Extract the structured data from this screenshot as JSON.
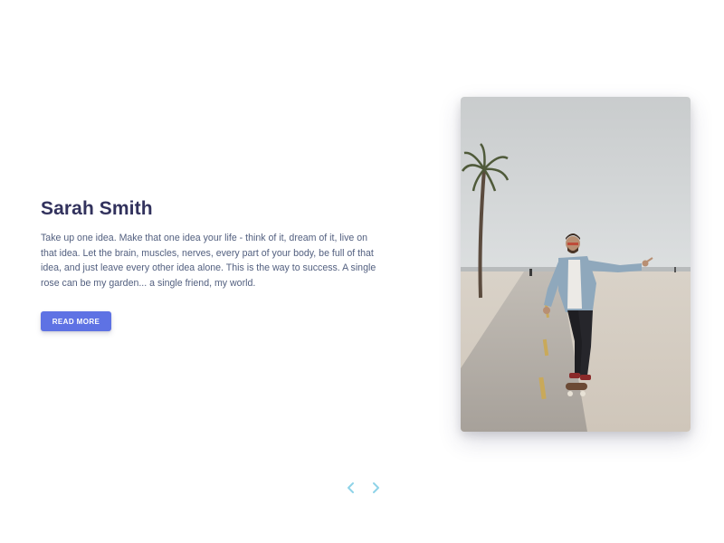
{
  "profile": {
    "name": "Sarah Smith",
    "description": "Take up one idea. Make that one idea your life - think of it, dream of it, live on that idea. Let the brain, muscles, nerves, every part of your body, be full of that idea, and just leave every other idea alone. This is the way to success. A single rose can be my garden... a single friend, my world.",
    "button_label": "READ MORE"
  },
  "photo": {
    "subject": "man skateboarding on beach boardwalk"
  },
  "carousel": {
    "prev_icon": "chevron-left-icon",
    "next_icon": "chevron-right-icon"
  },
  "colors": {
    "title": "#32325d",
    "text": "#525f7f",
    "button": "#5e72e4",
    "arrows": "#8fd3e8"
  }
}
